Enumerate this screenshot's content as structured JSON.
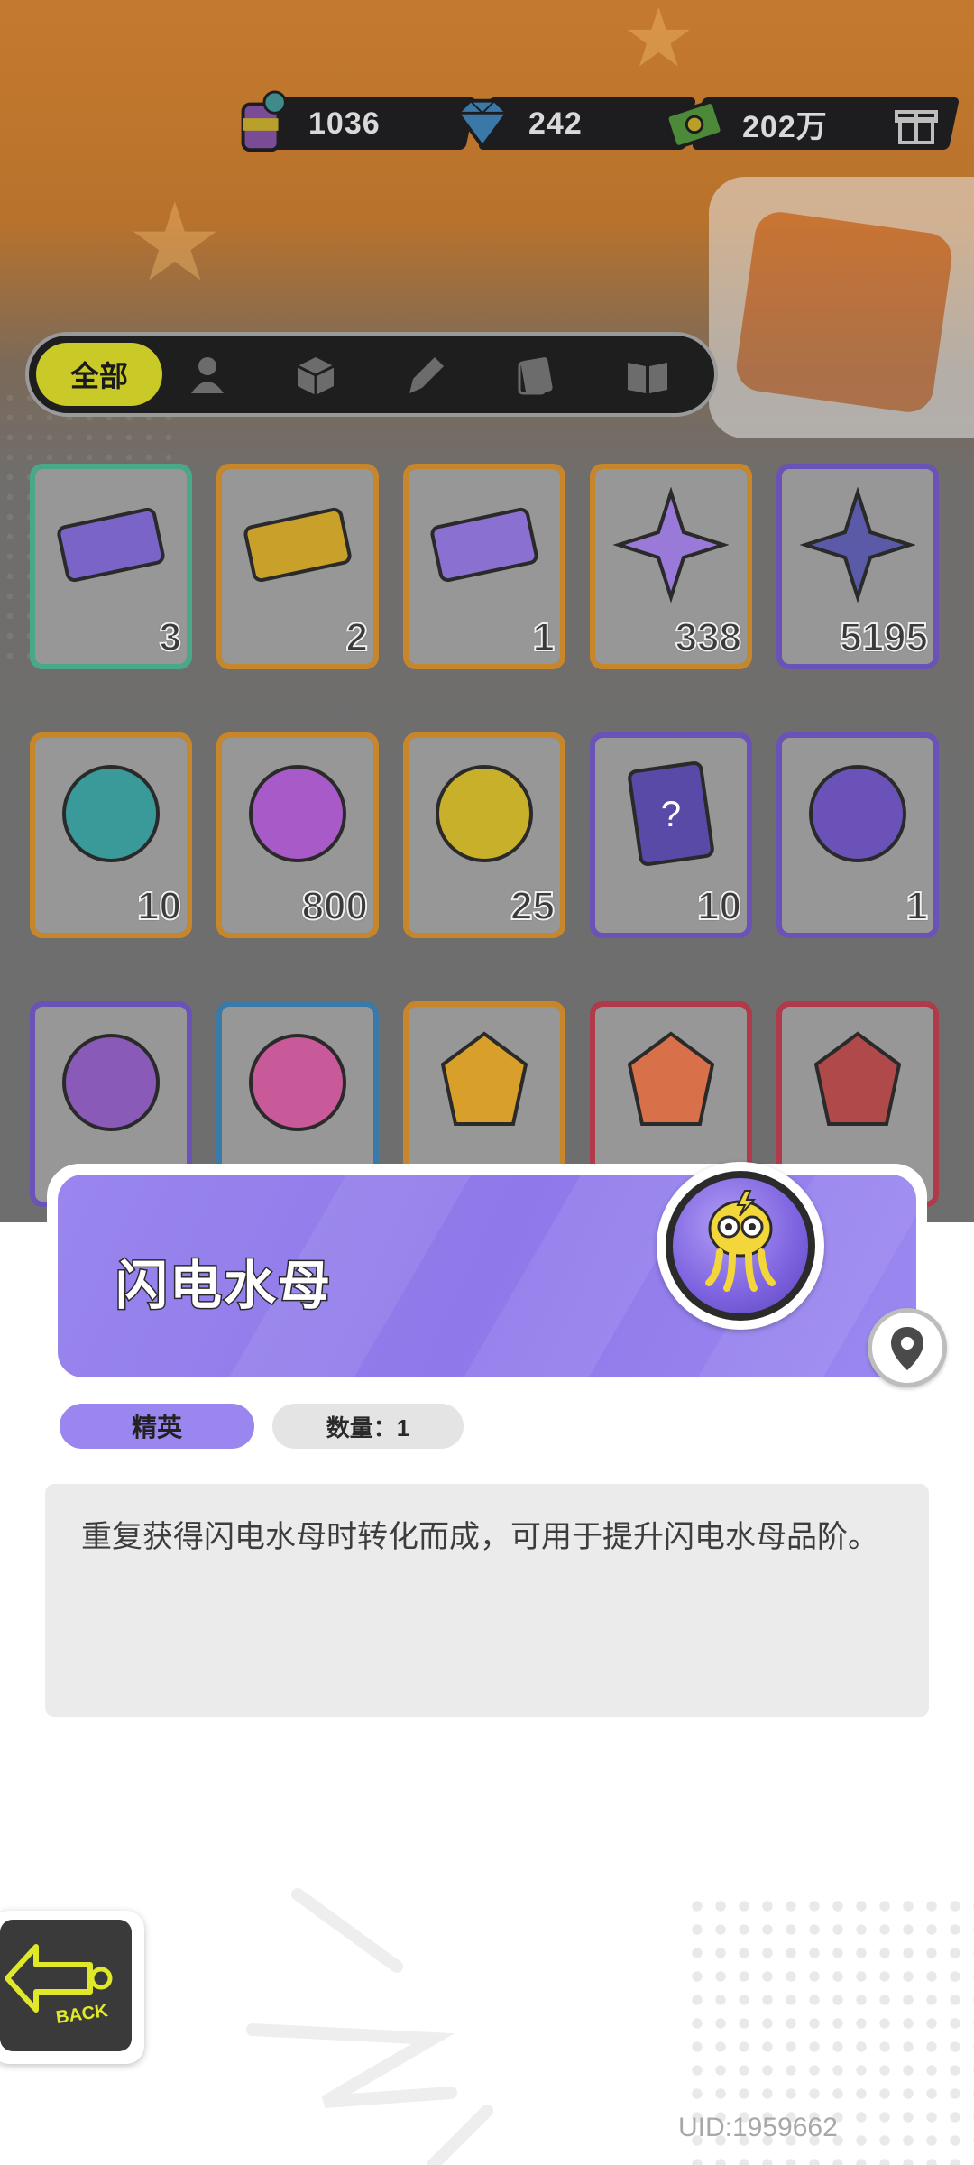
{
  "currencies": [
    {
      "name": "paint-can-currency",
      "value": "1036"
    },
    {
      "name": "diamond-currency",
      "value": "242"
    },
    {
      "name": "cash-currency",
      "value": "202万"
    }
  ],
  "tabs": [
    {
      "label": "全部",
      "icon": "all"
    },
    {
      "icon": "person-icon"
    },
    {
      "icon": "box-icon"
    },
    {
      "icon": "brush-icon"
    },
    {
      "icon": "card-icon"
    },
    {
      "icon": "book-icon"
    }
  ],
  "items": [
    {
      "count": "3",
      "icon": "purple-ticket-icon",
      "border": "#4aa88a"
    },
    {
      "count": "2",
      "icon": "gold-ticket-icon",
      "border": "#c8862a"
    },
    {
      "count": "1",
      "icon": "violet-ticket-icon",
      "border": "#c8862a"
    },
    {
      "count": "338",
      "icon": "rainbow-star-icon",
      "border": "#c8862a"
    },
    {
      "count": "5195",
      "icon": "blue-star-icon",
      "border": "#6a52b8"
    },
    {
      "count": "10",
      "icon": "block-cube-icon",
      "border": "#c8862a"
    },
    {
      "count": "800",
      "icon": "slime-ball-icon",
      "border": "#c8862a"
    },
    {
      "count": "25",
      "icon": "mystery-badge-icon",
      "border": "#c8862a"
    },
    {
      "count": "10",
      "icon": "mystery-card-icon",
      "border": "#6a52b8"
    },
    {
      "count": "1",
      "icon": "jellyfish-medal-icon",
      "border": "#6a52b8"
    },
    {
      "count": "",
      "icon": "spray-can-icon",
      "border": "#6a52b8"
    },
    {
      "count": "",
      "icon": "paint-tube-icon",
      "border": "#3a7aa8"
    },
    {
      "count": "",
      "icon": "gold-gem-icon",
      "border": "#c8862a"
    },
    {
      "count": "",
      "icon": "red-gem-icon",
      "border": "#b03a4a"
    },
    {
      "count": "",
      "icon": "ruby-gem-icon",
      "border": "#b03a4a"
    }
  ],
  "detail": {
    "title": "闪电水母",
    "rarity": "精英",
    "quantity": "数量：1",
    "description": "重复获得闪电水母时转化而成，可用于提升闪电水母品阶。"
  },
  "footer": {
    "uid": "UID:1959662",
    "back_label": "BACK"
  },
  "colors": {
    "accent_purple": "#9a86ee",
    "tab_active": "#c9c928",
    "text_dark": "#2a2a2a"
  }
}
